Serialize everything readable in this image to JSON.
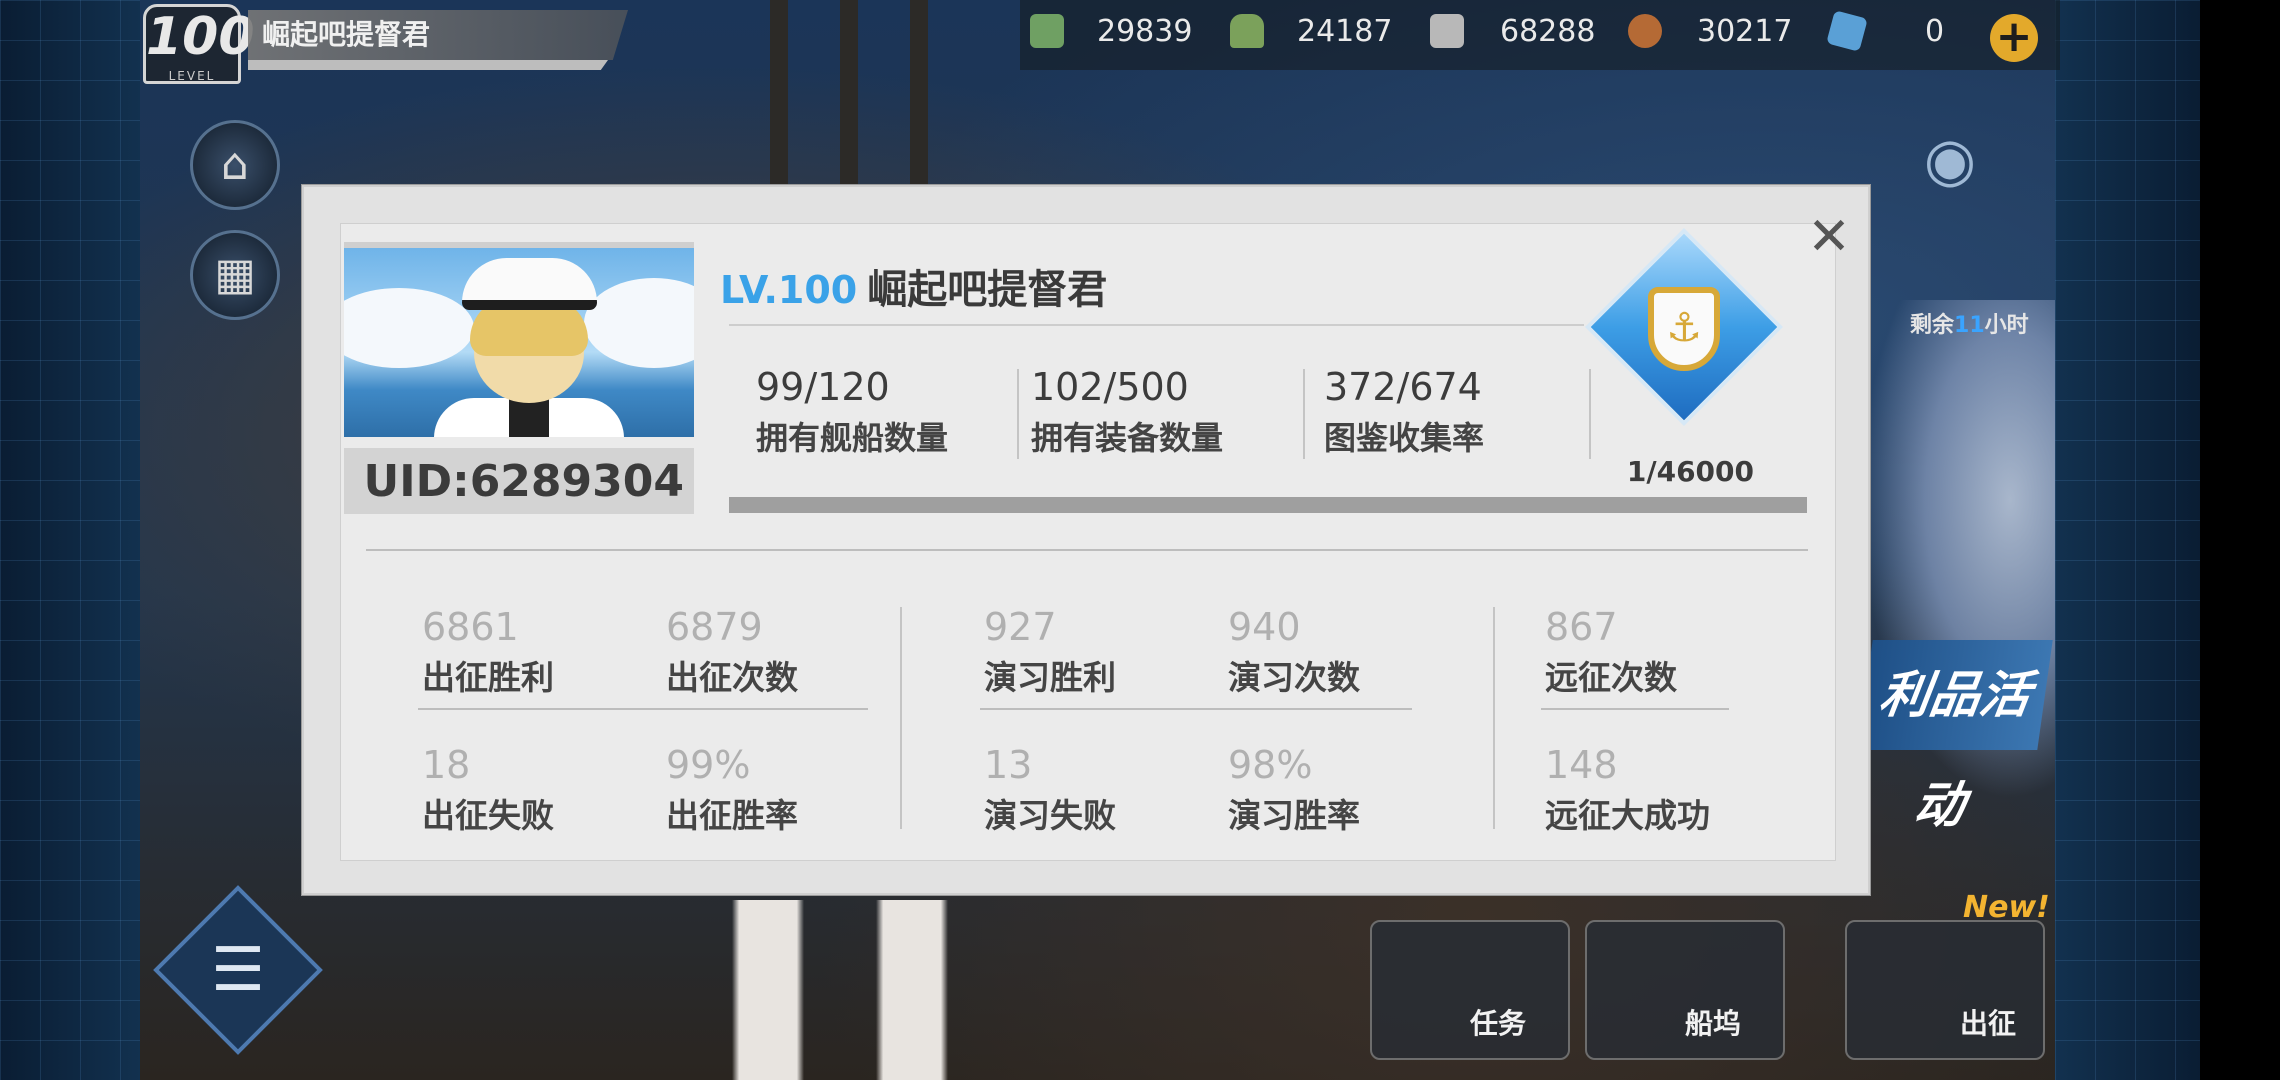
{
  "hud": {
    "level": "100",
    "level_word": "LEVEL",
    "player_name": "崛起吧提督君",
    "resources": [
      {
        "icon": "fuel-icon",
        "value": "29839",
        "color": "#6fa063"
      },
      {
        "icon": "ammo-icon",
        "value": "24187",
        "color": "#7ba15b"
      },
      {
        "icon": "steel-icon",
        "value": "68288",
        "color": "#b8b8b8"
      },
      {
        "icon": "aluminium-icon",
        "value": "30217",
        "color": "#b56a35"
      },
      {
        "icon": "diamond-icon",
        "value": "0",
        "color": "#5aa0d6"
      }
    ],
    "timer_prefix": "剩余",
    "timer_hours": "11",
    "timer_suffix": "小时",
    "event_banner": "利品活动",
    "new_tag": "New!",
    "bottom_buttons": [
      "任务",
      "船坞",
      "出征"
    ]
  },
  "profile": {
    "close_glyph": "✕",
    "uid_label": "UID:",
    "uid": "6289304",
    "lv_prefix": "LV.100",
    "name": "崛起吧提督君",
    "summary": [
      {
        "value": "99/120",
        "label": "拥有舰船数量"
      },
      {
        "value": "102/500",
        "label": "拥有装备数量"
      },
      {
        "value": "372/674",
        "label": "图鉴收集率"
      }
    ],
    "medal_progress": "1/46000",
    "medal_fraction": 2.17e-05,
    "stats": {
      "sortie_wins": {
        "value": "6861",
        "label": "出征胜利"
      },
      "sortie_count": {
        "value": "6879",
        "label": "出征次数"
      },
      "sortie_losses": {
        "value": "18",
        "label": "出征失败"
      },
      "sortie_rate": {
        "value": "99%",
        "label": "出征胜率"
      },
      "exercise_wins": {
        "value": "927",
        "label": "演习胜利"
      },
      "exercise_count": {
        "value": "940",
        "label": "演习次数"
      },
      "exercise_losses": {
        "value": "13",
        "label": "演习失败"
      },
      "exercise_rate": {
        "value": "98%",
        "label": "演习胜率"
      },
      "expedition_count": {
        "value": "867",
        "label": "远征次数"
      },
      "expedition_great": {
        "value": "148",
        "label": "远征大成功"
      }
    }
  },
  "colors": {
    "accent": "#3aa2e8",
    "modal_bg": "#e2e2e2",
    "stat_value": "#b0b0b0",
    "gold": "#e3a92b"
  }
}
